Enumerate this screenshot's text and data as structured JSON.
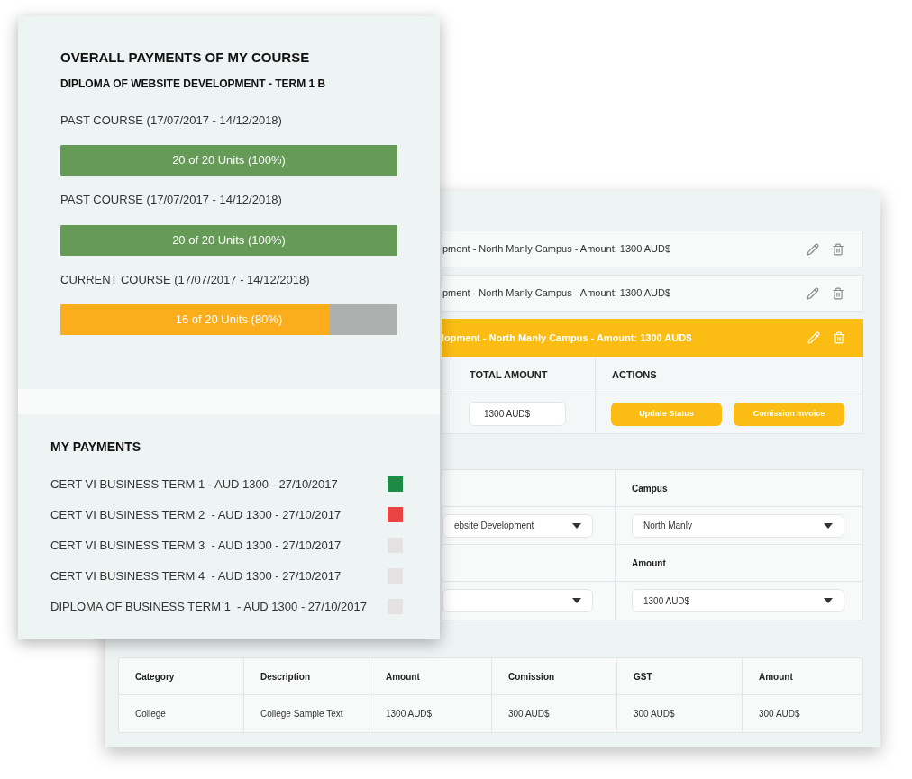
{
  "course_progress": {
    "title": "OVERALL PAYMENTS OF MY COURSE",
    "subtitle": "DIPLOMA OF WEBSITE DEVELOPMENT - TERM 1 B",
    "courses": [
      {
        "label": "PAST COURSE (17/07/2017 - 14/12/2018)",
        "bar_text": "20 of 20 Units (100%)",
        "level": 1,
        "color": "#659a57"
      },
      {
        "label": "PAST COURSE (17/07/2017 - 14/12/2018)",
        "bar_text": "20 of 20 Units (100%)",
        "level": 1,
        "color": "#659a57"
      },
      {
        "label": "CURRENT COURSE (17/07/2017 - 14/12/2018)",
        "bar_text": "16 of 20 Units (80%)",
        "level": 0.8,
        "color": "#fbad1c"
      }
    ]
  },
  "payments": {
    "title": "MY PAYMENTS",
    "items": [
      {
        "label": "CERT VI BUSINESS TERM 1 - AUD 1300 - 27/10/2017",
        "color": "#1e8a44"
      },
      {
        "label": "CERT VI BUSINESS TERM 2  - AUD 1300 - 27/10/2017",
        "color": "#e94343"
      },
      {
        "label": "CERT VI BUSINESS TERM 3  - AUD 1300 - 27/10/2017",
        "color": "#e4e2e2"
      },
      {
        "label": "CERT VI BUSINESS TERM 4  - AUD 1300 - 27/10/2017",
        "color": "#e4e2e2"
      },
      {
        "label": "DIPLOMA OF BUSINESS TERM 1  - AUD 1300 - 27/10/2017",
        "color": "#e4e2e2"
      }
    ]
  },
  "enrolments": [
    {
      "text": "pment - North Manly Campus - Amount: 1300 AUD$",
      "selected": false
    },
    {
      "text": "pment - North Manly Campus - Amount: 1300 AUD$",
      "selected": false
    },
    {
      "text": "lopment - North Manly Campus - Amount: 1300 AUD$",
      "selected": true
    }
  ],
  "details": {
    "columns": [
      "TOTAL AMOUNT",
      "ACTIONS"
    ],
    "total": "1300 AUD$",
    "buttons": [
      "Update Status",
      "Comission Invoice"
    ]
  },
  "form": {
    "rows": [
      {
        "left_value": "ebsite Development",
        "label": "Campus",
        "value": "North Manly"
      },
      {
        "label": "Amount",
        "value": "1300 AUD$"
      }
    ]
  },
  "prices": {
    "columns": [
      "Category",
      "Description",
      "Amount",
      "Comission",
      "GST",
      "Amount"
    ],
    "rows": [
      [
        "College",
        "College Sample Text",
        "1300 AUD$",
        "300 AUD$",
        "300 AUD$",
        "300 AUD$"
      ]
    ]
  }
}
